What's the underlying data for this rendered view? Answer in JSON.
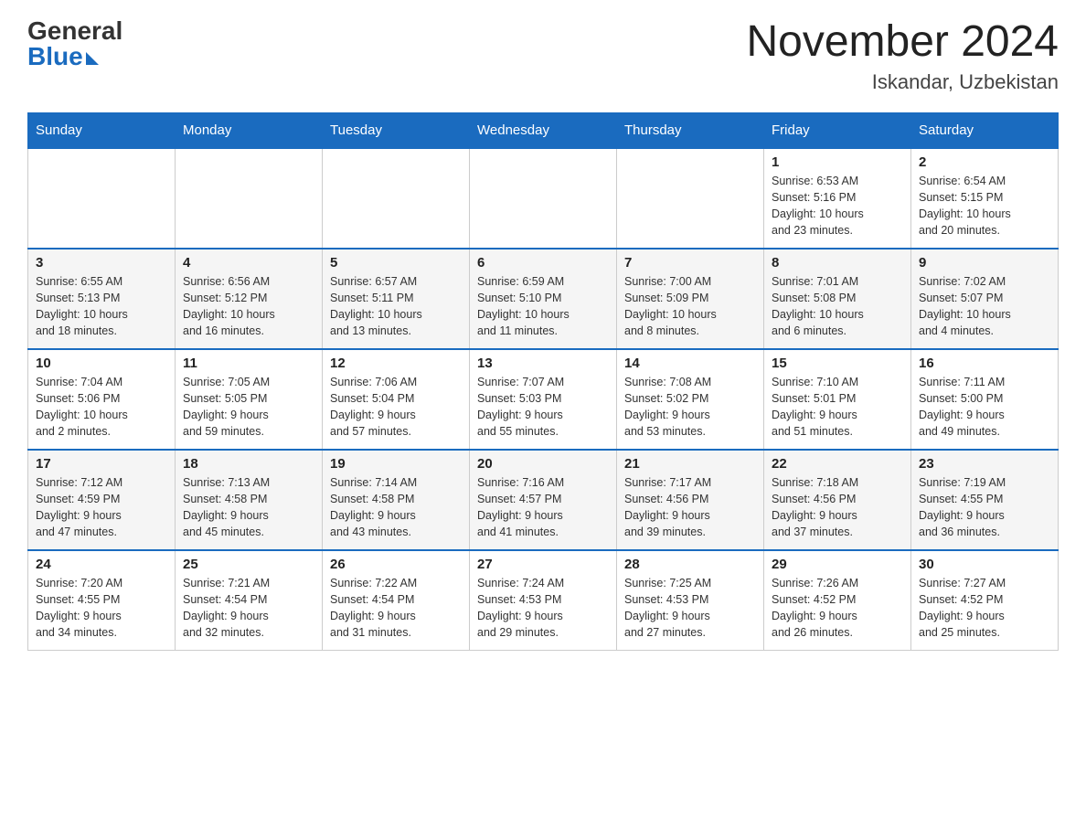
{
  "header": {
    "logo_general": "General",
    "logo_blue": "Blue",
    "month_year": "November 2024",
    "location": "Iskandar, Uzbekistan"
  },
  "weekdays": [
    "Sunday",
    "Monday",
    "Tuesday",
    "Wednesday",
    "Thursday",
    "Friday",
    "Saturday"
  ],
  "weeks": [
    {
      "days": [
        {
          "number": "",
          "info": ""
        },
        {
          "number": "",
          "info": ""
        },
        {
          "number": "",
          "info": ""
        },
        {
          "number": "",
          "info": ""
        },
        {
          "number": "",
          "info": ""
        },
        {
          "number": "1",
          "info": "Sunrise: 6:53 AM\nSunset: 5:16 PM\nDaylight: 10 hours\nand 23 minutes."
        },
        {
          "number": "2",
          "info": "Sunrise: 6:54 AM\nSunset: 5:15 PM\nDaylight: 10 hours\nand 20 minutes."
        }
      ]
    },
    {
      "days": [
        {
          "number": "3",
          "info": "Sunrise: 6:55 AM\nSunset: 5:13 PM\nDaylight: 10 hours\nand 18 minutes."
        },
        {
          "number": "4",
          "info": "Sunrise: 6:56 AM\nSunset: 5:12 PM\nDaylight: 10 hours\nand 16 minutes."
        },
        {
          "number": "5",
          "info": "Sunrise: 6:57 AM\nSunset: 5:11 PM\nDaylight: 10 hours\nand 13 minutes."
        },
        {
          "number": "6",
          "info": "Sunrise: 6:59 AM\nSunset: 5:10 PM\nDaylight: 10 hours\nand 11 minutes."
        },
        {
          "number": "7",
          "info": "Sunrise: 7:00 AM\nSunset: 5:09 PM\nDaylight: 10 hours\nand 8 minutes."
        },
        {
          "number": "8",
          "info": "Sunrise: 7:01 AM\nSunset: 5:08 PM\nDaylight: 10 hours\nand 6 minutes."
        },
        {
          "number": "9",
          "info": "Sunrise: 7:02 AM\nSunset: 5:07 PM\nDaylight: 10 hours\nand 4 minutes."
        }
      ]
    },
    {
      "days": [
        {
          "number": "10",
          "info": "Sunrise: 7:04 AM\nSunset: 5:06 PM\nDaylight: 10 hours\nand 2 minutes."
        },
        {
          "number": "11",
          "info": "Sunrise: 7:05 AM\nSunset: 5:05 PM\nDaylight: 9 hours\nand 59 minutes."
        },
        {
          "number": "12",
          "info": "Sunrise: 7:06 AM\nSunset: 5:04 PM\nDaylight: 9 hours\nand 57 minutes."
        },
        {
          "number": "13",
          "info": "Sunrise: 7:07 AM\nSunset: 5:03 PM\nDaylight: 9 hours\nand 55 minutes."
        },
        {
          "number": "14",
          "info": "Sunrise: 7:08 AM\nSunset: 5:02 PM\nDaylight: 9 hours\nand 53 minutes."
        },
        {
          "number": "15",
          "info": "Sunrise: 7:10 AM\nSunset: 5:01 PM\nDaylight: 9 hours\nand 51 minutes."
        },
        {
          "number": "16",
          "info": "Sunrise: 7:11 AM\nSunset: 5:00 PM\nDaylight: 9 hours\nand 49 minutes."
        }
      ]
    },
    {
      "days": [
        {
          "number": "17",
          "info": "Sunrise: 7:12 AM\nSunset: 4:59 PM\nDaylight: 9 hours\nand 47 minutes."
        },
        {
          "number": "18",
          "info": "Sunrise: 7:13 AM\nSunset: 4:58 PM\nDaylight: 9 hours\nand 45 minutes."
        },
        {
          "number": "19",
          "info": "Sunrise: 7:14 AM\nSunset: 4:58 PM\nDaylight: 9 hours\nand 43 minutes."
        },
        {
          "number": "20",
          "info": "Sunrise: 7:16 AM\nSunset: 4:57 PM\nDaylight: 9 hours\nand 41 minutes."
        },
        {
          "number": "21",
          "info": "Sunrise: 7:17 AM\nSunset: 4:56 PM\nDaylight: 9 hours\nand 39 minutes."
        },
        {
          "number": "22",
          "info": "Sunrise: 7:18 AM\nSunset: 4:56 PM\nDaylight: 9 hours\nand 37 minutes."
        },
        {
          "number": "23",
          "info": "Sunrise: 7:19 AM\nSunset: 4:55 PM\nDaylight: 9 hours\nand 36 minutes."
        }
      ]
    },
    {
      "days": [
        {
          "number": "24",
          "info": "Sunrise: 7:20 AM\nSunset: 4:55 PM\nDaylight: 9 hours\nand 34 minutes."
        },
        {
          "number": "25",
          "info": "Sunrise: 7:21 AM\nSunset: 4:54 PM\nDaylight: 9 hours\nand 32 minutes."
        },
        {
          "number": "26",
          "info": "Sunrise: 7:22 AM\nSunset: 4:54 PM\nDaylight: 9 hours\nand 31 minutes."
        },
        {
          "number": "27",
          "info": "Sunrise: 7:24 AM\nSunset: 4:53 PM\nDaylight: 9 hours\nand 29 minutes."
        },
        {
          "number": "28",
          "info": "Sunrise: 7:25 AM\nSunset: 4:53 PM\nDaylight: 9 hours\nand 27 minutes."
        },
        {
          "number": "29",
          "info": "Sunrise: 7:26 AM\nSunset: 4:52 PM\nDaylight: 9 hours\nand 26 minutes."
        },
        {
          "number": "30",
          "info": "Sunrise: 7:27 AM\nSunset: 4:52 PM\nDaylight: 9 hours\nand 25 minutes."
        }
      ]
    }
  ]
}
